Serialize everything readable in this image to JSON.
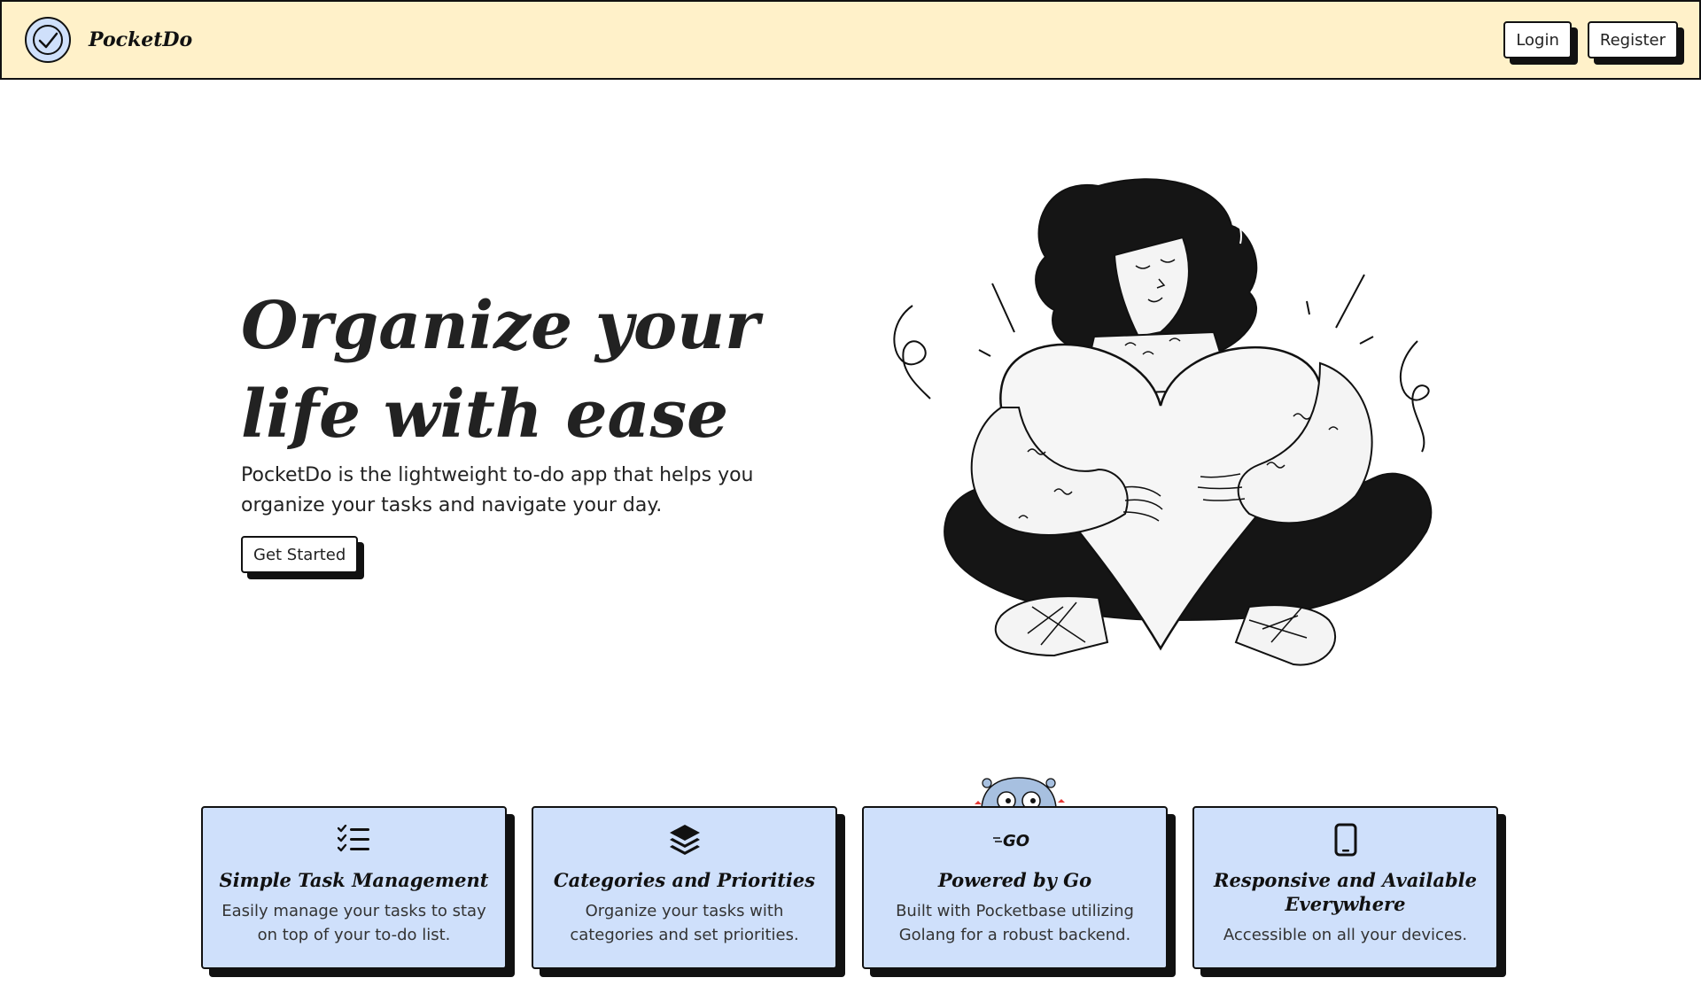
{
  "app": {
    "name": "PocketDo"
  },
  "nav": {
    "login_label": "Login",
    "register_label": "Register"
  },
  "hero": {
    "title_line1": "Organize your",
    "title_line2": "life with ease",
    "subtitle": "PocketDo is the lightweight to-do app that helps you organize your tasks and navigate your day.",
    "cta_label": "Get Started"
  },
  "features": [
    {
      "icon": "checklist-icon",
      "title": "Simple Task Management",
      "description": "Easily manage your tasks to stay on top of your to-do list."
    },
    {
      "icon": "layers-icon",
      "title": "Categories and Priorities",
      "description": "Organize your tasks with categories and set priorities."
    },
    {
      "icon": "go-logo-icon",
      "title": "Powered by Go",
      "description": "Built with Pocketbase utilizing Golang for a robust backend.",
      "icon_text": "GO"
    },
    {
      "icon": "mobile-icon",
      "title": "Responsive and Available Everywhere",
      "description": "Accessible on all your devices."
    }
  ],
  "colors": {
    "navbar_bg": "#fff1c9",
    "card_bg": "#cfe0fb",
    "border": "#111111"
  }
}
